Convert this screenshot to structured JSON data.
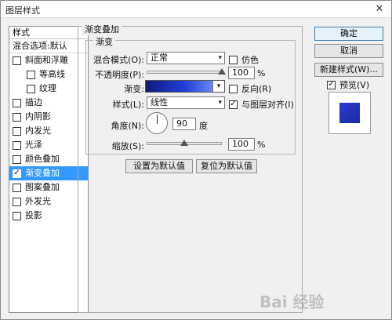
{
  "window": {
    "title": "图层样式",
    "close_glyph": "✕"
  },
  "styles_panel": {
    "header": "样式",
    "items": [
      {
        "label": "混合选项:默认",
        "has_checkbox": false,
        "checked": false,
        "indent": false,
        "selected": false
      },
      {
        "label": "斜面和浮雕",
        "has_checkbox": true,
        "checked": false,
        "indent": false,
        "selected": false
      },
      {
        "label": "等高线",
        "has_checkbox": true,
        "checked": false,
        "indent": true,
        "selected": false
      },
      {
        "label": "纹理",
        "has_checkbox": true,
        "checked": false,
        "indent": true,
        "selected": false
      },
      {
        "label": "描边",
        "has_checkbox": true,
        "checked": false,
        "indent": false,
        "selected": false
      },
      {
        "label": "内阴影",
        "has_checkbox": true,
        "checked": false,
        "indent": false,
        "selected": false
      },
      {
        "label": "内发光",
        "has_checkbox": true,
        "checked": false,
        "indent": false,
        "selected": false
      },
      {
        "label": "光泽",
        "has_checkbox": true,
        "checked": false,
        "indent": false,
        "selected": false
      },
      {
        "label": "颜色叠加",
        "has_checkbox": true,
        "checked": false,
        "indent": false,
        "selected": false
      },
      {
        "label": "渐变叠加",
        "has_checkbox": true,
        "checked": true,
        "indent": false,
        "selected": true
      },
      {
        "label": "图案叠加",
        "has_checkbox": true,
        "checked": false,
        "indent": false,
        "selected": false
      },
      {
        "label": "外发光",
        "has_checkbox": true,
        "checked": false,
        "indent": false,
        "selected": false
      },
      {
        "label": "投影",
        "has_checkbox": true,
        "checked": false,
        "indent": false,
        "selected": false
      }
    ]
  },
  "gradient_overlay": {
    "group_title": "渐变叠加",
    "sub_title": "渐变",
    "blend_mode": {
      "label": "混合模式(O):",
      "value": "正常"
    },
    "dither": {
      "label": "仿色",
      "checked": false
    },
    "opacity": {
      "label": "不透明度(P):",
      "value": "100",
      "unit": "%",
      "level": 1.0
    },
    "gradient": {
      "label": "渐变:",
      "colors": [
        "#0e1a7a",
        "#2040d8",
        "#8aa4ff"
      ]
    },
    "reverse": {
      "label": "反向(R)",
      "checked": false
    },
    "style": {
      "label": "样式(L):",
      "value": "线性"
    },
    "align_with_layer": {
      "label": "与图层对齐(I)",
      "checked": true
    },
    "angle": {
      "label": "角度(N):",
      "value": "90",
      "unit": "度"
    },
    "scale": {
      "label": "缩放(S):",
      "value": "100",
      "unit": "%",
      "level": 0.5
    },
    "make_default_label": "设置为默认值",
    "reset_default_label": "复位为默认值"
  },
  "right_buttons": {
    "ok": "确定",
    "cancel": "取消",
    "new_style": "新建样式(W)...",
    "preview": {
      "label": "预览(V)",
      "checked": true
    }
  },
  "preview_color": "#2238c8",
  "watermark": "Bai 经验"
}
